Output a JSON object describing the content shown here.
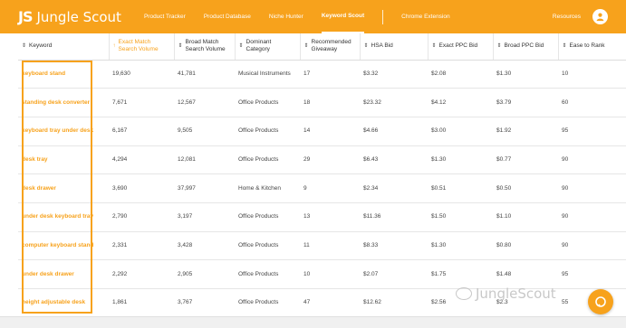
{
  "brand": {
    "mark": "JS",
    "name": "Jungle Scout"
  },
  "nav": {
    "items": [
      "Product Tracker",
      "Product Database",
      "Niche Hunter",
      "Keyword Scout"
    ],
    "extension": "Chrome Extension",
    "resources": "Resources"
  },
  "table": {
    "headers": [
      "Keyword",
      "Exact Match Search Volume",
      "Broad Match Search Volume",
      "Dominant Category",
      "Recommended Giveaway",
      "HSA Bid",
      "Exact PPC Bid",
      "Broad PPC Bid",
      "Ease to Rank"
    ],
    "rows": [
      [
        "keyboard stand",
        "19,630",
        "41,781",
        "Musical Instruments",
        "17",
        "$3.32",
        "$2.08",
        "$1.30",
        "10"
      ],
      [
        "standing desk converter",
        "7,671",
        "12,567",
        "Office Products",
        "18",
        "$23.32",
        "$4.12",
        "$3.79",
        "60"
      ],
      [
        "keyboard tray under desk",
        "6,167",
        "9,505",
        "Office Products",
        "14",
        "$4.66",
        "$3.00",
        "$1.92",
        "95"
      ],
      [
        "desk tray",
        "4,294",
        "12,081",
        "Office Products",
        "29",
        "$6.43",
        "$1.30",
        "$0.77",
        "90"
      ],
      [
        "desk drawer",
        "3,690",
        "37,997",
        "Home & Kitchen",
        "9",
        "$2.34",
        "$0.51",
        "$0.50",
        "90"
      ],
      [
        "under desk keyboard tray",
        "2,790",
        "3,197",
        "Office Products",
        "13",
        "$11.36",
        "$1.50",
        "$1.10",
        "90"
      ],
      [
        "computer keyboard stand",
        "2,331",
        "3,428",
        "Office Products",
        "11",
        "$8.33",
        "$1.30",
        "$0.80",
        "90"
      ],
      [
        "under desk drawer",
        "2,292",
        "2,905",
        "Office Products",
        "10",
        "$2.07",
        "$1.75",
        "$1.48",
        "95"
      ],
      [
        "height adjustable desk",
        "1,861",
        "3,767",
        "Office Products",
        "47",
        "$12.62",
        "$2.56",
        "$2.3",
        "55"
      ]
    ]
  },
  "watermark": {
    "text": "JungleScout"
  },
  "colors": {
    "brand_orange": "#f7a21c"
  }
}
